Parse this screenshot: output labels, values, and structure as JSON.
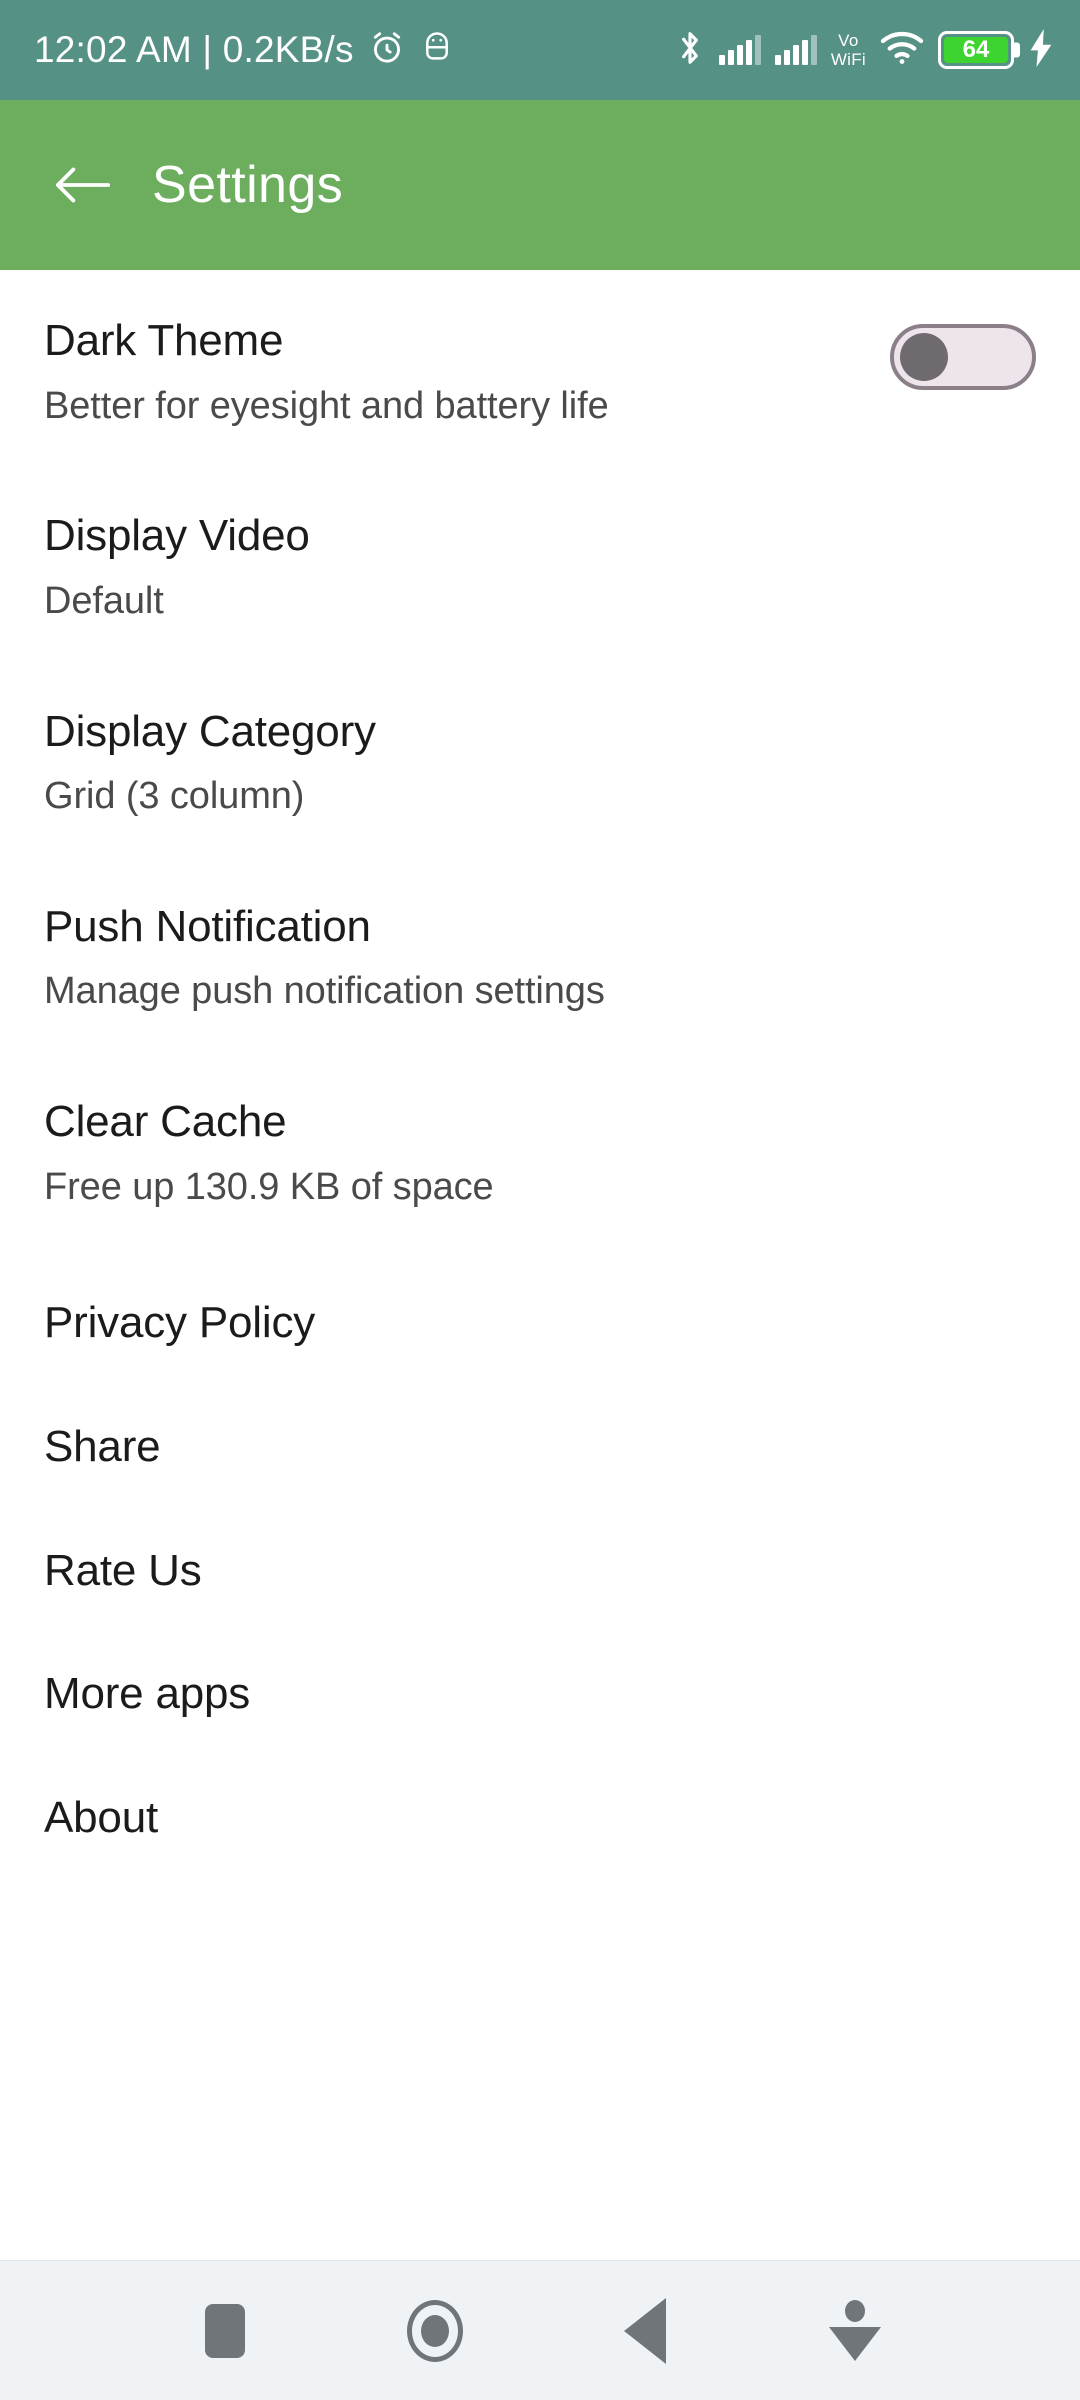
{
  "status_bar": {
    "clock": "12:02 AM | 0.2KB/s",
    "icons": [
      "alarm-icon",
      "android-debug-icon",
      "bluetooth-icon",
      "signal-sim1-icon",
      "signal-sim2-icon",
      "vowifi-icon",
      "wifi-icon",
      "battery-icon",
      "charging-bolt-icon"
    ],
    "vowifi_line1": "Vo",
    "vowifi_line2": "WiFi",
    "battery_level": "64",
    "colors": {
      "background": "#559185",
      "foreground": "#ffffff",
      "battery_fill": "#3ED430"
    }
  },
  "app_bar": {
    "back_icon": "arrow-left-icon",
    "title": "Settings",
    "colors": {
      "background": "#6CAE5E",
      "foreground": "#ffffff"
    }
  },
  "settings": {
    "items": [
      {
        "title": "Dark Theme",
        "subtitle": "Better for eyesight and battery life",
        "control": "toggle",
        "toggle_state": "off"
      },
      {
        "title": "Display Video",
        "subtitle": "Default",
        "control": "none"
      },
      {
        "title": "Display Category",
        "subtitle": "Grid (3 column)",
        "control": "none"
      },
      {
        "title": "Push Notification",
        "subtitle": "Manage push notification settings",
        "control": "none"
      },
      {
        "title": "Clear Cache",
        "subtitle": "Free up 130.9 KB of space",
        "control": "none"
      },
      {
        "title": "Privacy Policy",
        "subtitle": "",
        "control": "none"
      },
      {
        "title": "Share",
        "subtitle": "",
        "control": "none"
      },
      {
        "title": "Rate Us",
        "subtitle": "",
        "control": "none"
      },
      {
        "title": "More apps",
        "subtitle": "",
        "control": "none"
      },
      {
        "title": "About",
        "subtitle": "",
        "control": "none"
      }
    ]
  },
  "nav_bar": {
    "buttons": [
      {
        "name": "recents-square-icon"
      },
      {
        "name": "home-circle-icon"
      },
      {
        "name": "back-triangle-icon"
      },
      {
        "name": "hide-keyboard-icon"
      }
    ],
    "colors": {
      "background": "#EFF3F6",
      "foreground": "#70757A"
    }
  }
}
